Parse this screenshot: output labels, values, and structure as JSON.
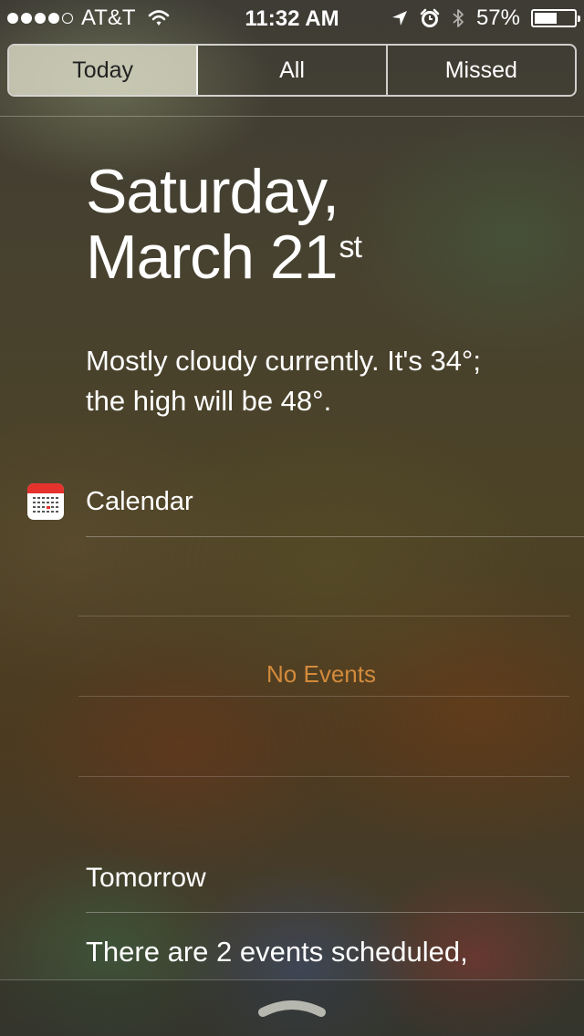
{
  "status_bar": {
    "signal_bars_filled": 4,
    "signal_bars_total": 5,
    "carrier": "AT&T",
    "time": "11:32 AM",
    "battery_percent": "57%",
    "battery_level": 0.57,
    "icons": [
      "wifi-icon",
      "location-arrow-icon",
      "alarm-clock-icon",
      "bluetooth-icon",
      "battery-icon"
    ]
  },
  "tabs": [
    {
      "label": "Today",
      "active": true
    },
    {
      "label": "All",
      "active": false
    },
    {
      "label": "Missed",
      "active": false
    }
  ],
  "today": {
    "weekday": "Saturday,",
    "month_day": "March 21",
    "ordinal_suffix": "st",
    "weather_line1": "Mostly cloudy currently. It's 34°;",
    "weather_line2": "the high will be 48°."
  },
  "calendar": {
    "section_label": "Calendar",
    "empty_message": "No Events",
    "colors": {
      "empty_message": "#d38a3c",
      "icon_header": "#e5322d"
    }
  },
  "tomorrow": {
    "label": "Tomorrow",
    "summary": "There are 2 events scheduled,"
  }
}
